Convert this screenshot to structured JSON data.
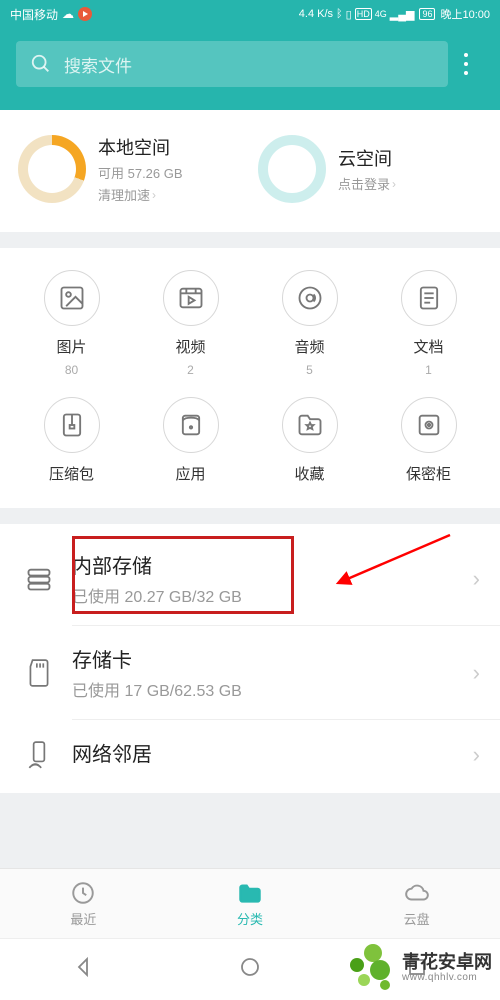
{
  "status": {
    "carrier": "中国移动",
    "speed": "4.4 K/s",
    "hd": "HD",
    "net": "4G",
    "battery": "96",
    "time": "晚上10:00"
  },
  "search": {
    "placeholder": "搜索文件"
  },
  "storage_cards": {
    "local": {
      "title": "本地空间",
      "sub": "可用 57.26 GB",
      "link": "清理加速"
    },
    "cloud": {
      "title": "云空间",
      "link": "点击登录"
    }
  },
  "categories": [
    {
      "label": "图片",
      "count": "80"
    },
    {
      "label": "视频",
      "count": "2"
    },
    {
      "label": "音频",
      "count": "5"
    },
    {
      "label": "文档",
      "count": "1"
    },
    {
      "label": "压缩包",
      "count": ""
    },
    {
      "label": "应用",
      "count": ""
    },
    {
      "label": "收藏",
      "count": ""
    },
    {
      "label": "保密柜",
      "count": ""
    }
  ],
  "storage_list": {
    "internal": {
      "title": "内部存储",
      "sub": "已使用 20.27 GB/32 GB"
    },
    "sdcard": {
      "title": "存储卡",
      "sub": "已使用 17 GB/62.53 GB"
    },
    "network": {
      "title": "网络邻居"
    }
  },
  "tabs": {
    "recent": "最近",
    "category": "分类",
    "cloud": "云盘"
  },
  "watermark": {
    "brand": "青花安卓网",
    "url": "www.qhhlv.com"
  },
  "colors": {
    "accent": "#26b5ad",
    "highlight": "#c81e1e",
    "arrow": "#ff0000"
  }
}
